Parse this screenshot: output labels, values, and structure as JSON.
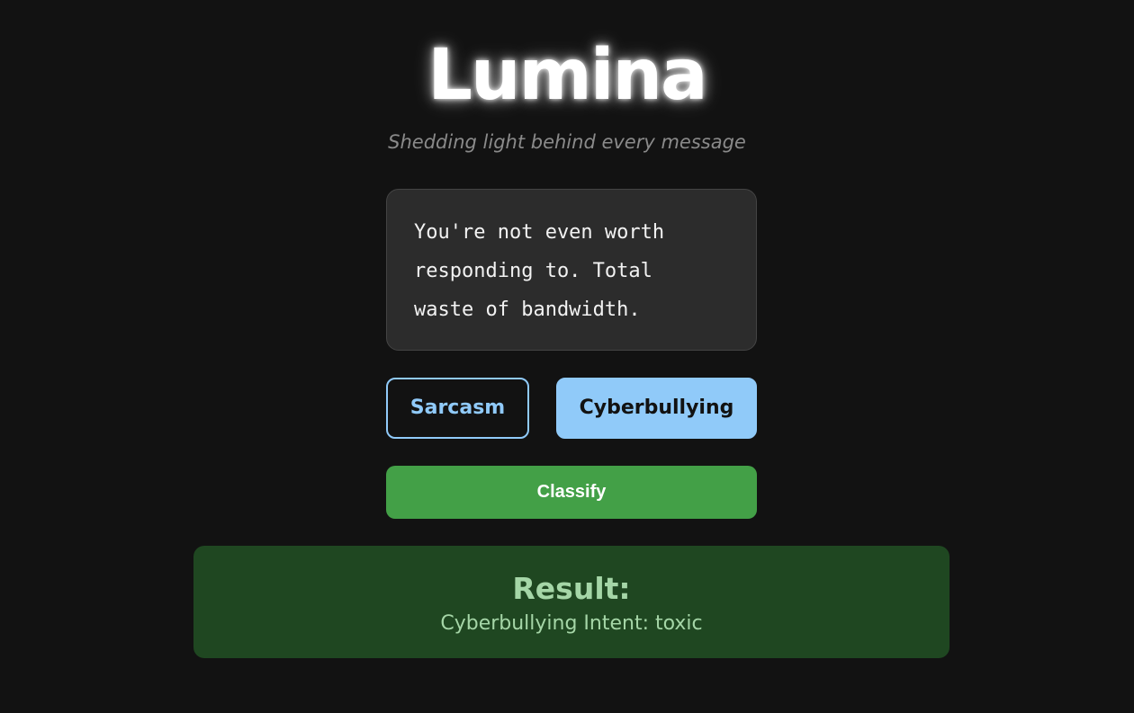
{
  "app": {
    "title": "Lumina",
    "subtitle": "Shedding light behind every message"
  },
  "input": {
    "value": "You're not even worth\nresponding to. Total\nwaste of bandwidth."
  },
  "modes": {
    "sarcasm_label": "Sarcasm",
    "cyberbullying_label": "Cyberbullying",
    "selected": "Cyberbullying"
  },
  "actions": {
    "classify_label": "Classify"
  },
  "result": {
    "heading": "Result:",
    "text": "Cyberbullying Intent: toxic"
  },
  "colors": {
    "background": "#121212",
    "accent_blue": "#90caf9",
    "classify_green": "#43a047",
    "result_bg": "#1f4721",
    "result_text": "#a5d6a7"
  }
}
